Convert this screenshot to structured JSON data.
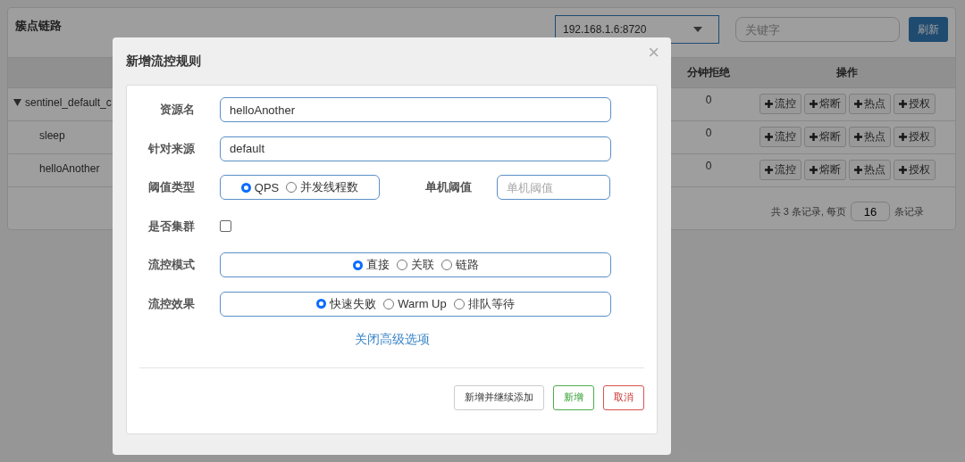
{
  "page": {
    "title": "簇点链路",
    "machine_select": {
      "value": "192.168.1.6:8720"
    },
    "search": {
      "placeholder": "关键字"
    },
    "refresh_button": "刷新"
  },
  "table": {
    "columns": [
      "分钟拒绝",
      "操作"
    ],
    "rows": [
      {
        "resource": "sentinel_default_c",
        "expanded": true,
        "minute_rejected": "0",
        "actions": [
          "流控",
          "熔断",
          "热点",
          "授权"
        ],
        "children": [
          {
            "resource": "sleep",
            "minute_rejected": "0",
            "actions": [
              "流控",
              "熔断",
              "热点",
              "授权"
            ]
          },
          {
            "resource": "helloAnother",
            "minute_rejected": "0",
            "actions": [
              "流控",
              "熔断",
              "热点",
              "授权"
            ]
          }
        ]
      }
    ]
  },
  "pagination": {
    "summary": "共 3 条记录, 每页",
    "page_size": "16",
    "suffix": "条记录"
  },
  "modal": {
    "title": "新增流控规则",
    "close": "×",
    "fields": [
      {
        "kind": "text",
        "label": "资源名",
        "value": "helloAnother"
      },
      {
        "kind": "text",
        "label": "针对来源",
        "value": "default"
      },
      {
        "kind": "radio",
        "label": "阈值类型",
        "options": [
          {
            "label": "QPS",
            "selected": true
          },
          {
            "label": "并发线程数",
            "selected": false
          }
        ],
        "threshold": {
          "label": "单机阈值",
          "placeholder": "单机阈值"
        }
      },
      {
        "kind": "checkbox",
        "label": "是否集群",
        "checked": false
      },
      {
        "kind": "radio",
        "label": "流控模式",
        "options": [
          {
            "label": "直接",
            "selected": true
          },
          {
            "label": "关联",
            "selected": false
          },
          {
            "label": "链路",
            "selected": false
          }
        ]
      },
      {
        "kind": "radio",
        "label": "流控效果",
        "options": [
          {
            "label": "快速失败",
            "selected": true
          },
          {
            "label": "Warm Up",
            "selected": false
          },
          {
            "label": "排队等待",
            "selected": false
          }
        ]
      }
    ],
    "advanced_link": "关闭高级选项",
    "buttons": [
      {
        "label": "新增并继续添加",
        "kind": "default"
      },
      {
        "label": "新增",
        "kind": "success"
      },
      {
        "label": "取消",
        "kind": "danger"
      }
    ]
  }
}
